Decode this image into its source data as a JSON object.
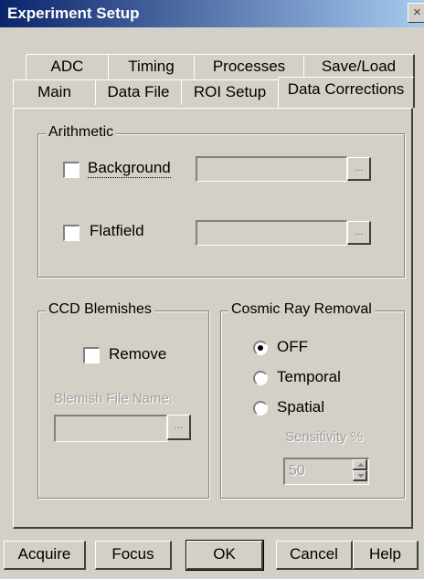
{
  "window": {
    "title": "Experiment Setup",
    "close_label": "×"
  },
  "tabs_back": [
    "ADC",
    "Timing",
    "Processes",
    "Save/Load"
  ],
  "tabs_front": [
    "Main",
    "Data File",
    "ROI Setup",
    "Data Corrections"
  ],
  "active_tab": "Data Corrections",
  "arithmetic": {
    "group_label": "Arithmetic",
    "background_label": "Background",
    "background_checked": false,
    "background_file": "",
    "flatfield_label": "Flatfield",
    "flatfield_checked": false,
    "flatfield_file": "",
    "browse_label": "..."
  },
  "ccd_blemishes": {
    "group_label": "CCD Blemishes",
    "remove_label": "Remove",
    "remove_checked": false,
    "file_label": "Blemish File Name:",
    "file_value": "",
    "browse_label": "..."
  },
  "cosmic_ray": {
    "group_label": "Cosmic Ray Removal",
    "options": [
      "OFF",
      "Temporal",
      "Spatial"
    ],
    "selected": "OFF",
    "sensitivity_label": "Sensitivity %",
    "sensitivity_value": "50"
  },
  "buttons": {
    "acquire": "Acquire",
    "focus": "Focus",
    "ok": "OK",
    "cancel": "Cancel",
    "help": "Help"
  }
}
